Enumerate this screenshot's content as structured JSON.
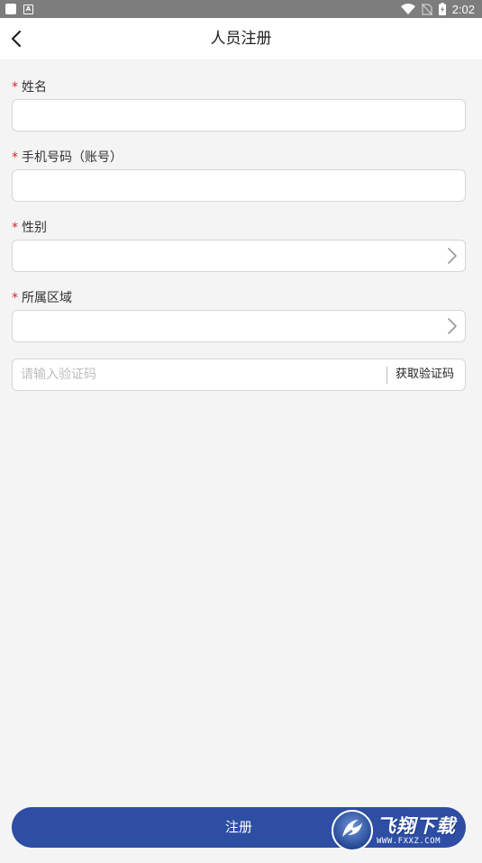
{
  "status_bar": {
    "time": "2:02"
  },
  "header": {
    "title": "人员注册"
  },
  "form": {
    "required_mark": "*",
    "name_label": "姓名",
    "phone_label": "手机号码（账号）",
    "gender_label": "性别",
    "region_label": "所属区域",
    "code_placeholder": "请输入验证码",
    "get_code_label": "获取验证码"
  },
  "submit_label": "注册",
  "watermark": {
    "brand": "飞翔下载",
    "url": "WWW.FXXZ.COM"
  },
  "colors": {
    "accent": "#2d4ea3",
    "required": "#e02020",
    "background": "#f4f4f4",
    "status_bar": "#7d7d7d"
  }
}
